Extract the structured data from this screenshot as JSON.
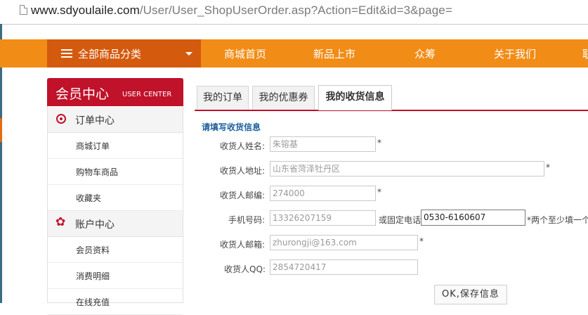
{
  "browser": {
    "url_host": "www.sdyoulaile.com",
    "url_path": "/User/User_ShopUserOrder.asp?Action=Edit&id=3&page="
  },
  "nav": {
    "category_label": "全部商品分类",
    "items": [
      "商城首页",
      "新品上市",
      "众筹",
      "关于我们",
      "联"
    ]
  },
  "sidebar": {
    "title": "会员中心",
    "subtitle": "USER CENTER",
    "sections": [
      {
        "label": "订单中心",
        "icon": "target-icon",
        "items": [
          "商城订单",
          "购物车商品",
          "收藏夹"
        ]
      },
      {
        "label": "账户中心",
        "icon": "gear-icon",
        "items": [
          "会员资料",
          "消费明细",
          "在线充值"
        ]
      }
    ]
  },
  "tabs": [
    "我的订单",
    "我的优惠券",
    "我的收货信息"
  ],
  "active_tab": "我的收货信息",
  "form": {
    "title": "请填写收货信息",
    "name_label": "收货人姓名:",
    "name_value": "朱镕基",
    "address_label": "收货人地址:",
    "address_value": "山东省菏泽牡丹区",
    "zip_label": "收货人邮编:",
    "zip_value": "274000",
    "mobile_label": "手机号码:",
    "mobile_value": "13326207159",
    "phone_label": "或固定电话",
    "phone_value": "0530-6160607",
    "phone_note": "*两个至少填一个",
    "email_label": "收货人邮箱:",
    "email_value": "zhurongji@163.com",
    "qq_label": "收货人QQ:",
    "qq_value": "2854720417",
    "required_mark": "*",
    "submit_label": "OK,保存信息"
  },
  "colors": {
    "nav_orange": "#f18c16",
    "category_orange": "#d45a0e",
    "brand_red": "#c0122a",
    "link_blue": "#1d5f9e"
  }
}
